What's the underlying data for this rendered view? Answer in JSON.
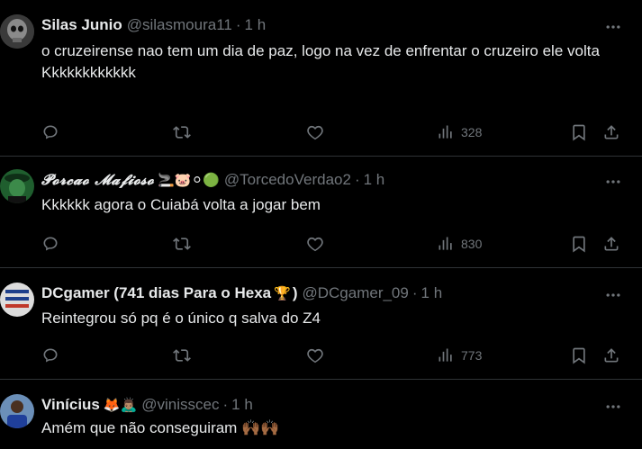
{
  "tweets": [
    {
      "name": "Silas Junio",
      "handle": "@silasmoura11",
      "time": "1 h",
      "text": "o cruzeirense nao tem um dia de paz, logo na vez de enfrentar o cruzeiro ele volta\nKkkkkkkkkkkk",
      "views": "328",
      "avatar_icon": "skull-avatar"
    },
    {
      "name": "𝓟𝓸𝓻𝓬𝓪𝓸 𝓜𝓪𝓯𝓲𝓸𝓼𝓸",
      "name_emojis": "🚬🐷⚪🟢",
      "handle": "@TorcedoVerdao2",
      "time": "1 h",
      "text": "Kkkkkk agora o Cuiabá volta a jogar bem",
      "views": "830",
      "avatar_icon": "mafioso-avatar"
    },
    {
      "name": "DCgamer (741 dias Para o Hexa",
      "name_trophy": "🏆",
      "name_close": ")",
      "handle": "@DCgamer_09",
      "time": "1 h",
      "text": "Reintegrou só pq é o único q salva do Z4",
      "views": "773",
      "avatar_icon": "flag-avatar"
    },
    {
      "name": "Vinícius",
      "name_emojis": "🦊🙇🏽‍♂️",
      "handle": "@vinisscec",
      "time": "1 h",
      "text": "Amém que não conseguiram 🙌🏾🙌🏾",
      "avatar_icon": "player-avatar"
    }
  ],
  "colors": {
    "background": "#000000",
    "text": "#e7e9ea",
    "muted": "#71767b",
    "divider": "#2f3336"
  }
}
